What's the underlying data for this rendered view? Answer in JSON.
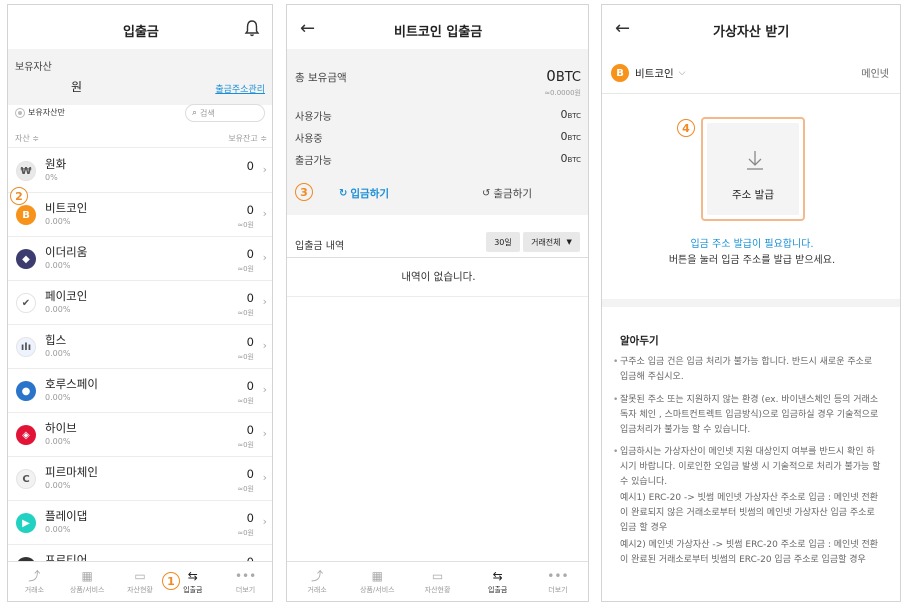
{
  "colors": {
    "accent_orange": "#f08a24",
    "link_blue": "#1a8fd6",
    "gray_bg": "#f3f3f3"
  },
  "panel1": {
    "title": "입출금",
    "holding_label": "보유자산",
    "holding_value": "원",
    "deposit_address_link": "출금주소관리",
    "holding_only_label": "보유자산만",
    "search_placeholder": "검색",
    "col_asset": "자산 ≑",
    "col_balance": "보유잔고 ≑",
    "marker_2": "2",
    "marker_1": "1",
    "coins": [
      {
        "name": "원화",
        "pct": "0%",
        "amount": "0",
        "won": "",
        "icon": "won-icon",
        "color": "#e9e9e9",
        "glyph": "₩"
      },
      {
        "name": "비트코인",
        "pct": "0.00%",
        "amount": "0",
        "won": "≈0원",
        "icon": "bitcoin-icon",
        "color": "#f7931a",
        "glyph": "B"
      },
      {
        "name": "이더리움",
        "pct": "0.00%",
        "amount": "0",
        "won": "≈0원",
        "icon": "ethereum-icon",
        "color": "#3c3c6e",
        "glyph": "◆"
      },
      {
        "name": "페이코인",
        "pct": "0.00%",
        "amount": "0",
        "won": "≈0원",
        "icon": "paycoin-icon",
        "color": "#ffffff",
        "glyph": "✔"
      },
      {
        "name": "힙스",
        "pct": "0.00%",
        "amount": "0",
        "won": "≈0원",
        "icon": "hips-icon",
        "color": "#eef4ff",
        "glyph": "ılı"
      },
      {
        "name": "호루스페이",
        "pct": "0.00%",
        "amount": "0",
        "won": "≈0원",
        "icon": "horuspay-icon",
        "color": "#2a74c9",
        "glyph": "●"
      },
      {
        "name": "하이브",
        "pct": "0.00%",
        "amount": "0",
        "won": "≈0원",
        "icon": "hive-icon",
        "color": "#e31337",
        "glyph": "◈"
      },
      {
        "name": "피르마체인",
        "pct": "0.00%",
        "amount": "0",
        "won": "≈0원",
        "icon": "firmachain-icon",
        "color": "#f2f2f2",
        "glyph": "C"
      },
      {
        "name": "플레이댑",
        "pct": "0.00%",
        "amount": "0",
        "won": "≈0원",
        "icon": "playdapp-icon",
        "color": "#21d1c2",
        "glyph": "▶"
      },
      {
        "name": "프로티어",
        "pct": "",
        "amount": "0",
        "won": "",
        "icon": "frontier-icon",
        "color": "#333333",
        "glyph": ""
      }
    ]
  },
  "nav": [
    {
      "label": "거래소",
      "icon": "chart-line-icon",
      "glyph": "⤴"
    },
    {
      "label": "상품/서비스",
      "icon": "grid-icon",
      "glyph": "▦"
    },
    {
      "label": "자산현황",
      "icon": "wallet-icon",
      "glyph": "▭"
    },
    {
      "label": "입출금",
      "icon": "transfer-icon",
      "glyph": "⇆"
    },
    {
      "label": "더보기",
      "icon": "more-icon",
      "glyph": "•••"
    }
  ],
  "panel2": {
    "title": "비트코인 입출금",
    "total_label": "총 보유금액",
    "total_value": "0",
    "total_unit": "BTC",
    "total_won": "≈0.0000원",
    "available_label": "사용가능",
    "available_value": "0",
    "in_use_label": "사용중",
    "in_use_value": "0",
    "withdrawable_label": "출금가능",
    "withdrawable_value": "0",
    "unit_small": "BTC",
    "marker_3": "3",
    "deposit_btn": "입금하기",
    "withdraw_btn": "출금하기",
    "history_label": "입출금 내역",
    "period_btn": "30일",
    "type_btn": "거래전체",
    "empty_text": "내역이 없습니다."
  },
  "panel3": {
    "title": "가상자산 받기",
    "coin_name": "비트코인",
    "network": "메인넷",
    "marker_4": "4",
    "issue_btn": "주소 발급",
    "need_text": "입금 주소 발급이 필요합니다.",
    "instruction": "버튼을 눌러 입금 주소를 발급 받으세요.",
    "notice_title": "알아두기",
    "notices": [
      "구주소 입금 건은 입금 처리가 불가능 합니다. 반드시 새로운 주소로 입금해 주십시오.",
      "잘못된 주소 또는 지원하지 않는 환경 (ex. 바이낸스체인 등의 거래소 독자 체인 , 스마트컨트렉트 입금방식)으로 입금하실 경우 기술적으로 입금처리가 불가능 할 수 있습니다.",
      "입금하시는 가상자산이 메인넷 지원 대상인지 여부를 반드시 확인 하시기 바랍니다. 이로인한 오입금 발생 시 기술적으로 처리가 불가능 할 수 있습니다."
    ],
    "example1": "예시1) ERC-20 -> 빗썸 메인넷 가상자산 주소로 입금 : 메인넷 전환이 완료되지 않은 거래소로부터 빗썸의 메인넷 가상자산 입금 주소로 입금 할 경우",
    "example2": "예시2) 메인넷 가상자산 -> 빗썸 ERC-20 주소로 입금 : 메인넷 전환이 완료된 거래소로부터 빗썸의 ERC-20 입금 주소로 입금할 경우"
  }
}
